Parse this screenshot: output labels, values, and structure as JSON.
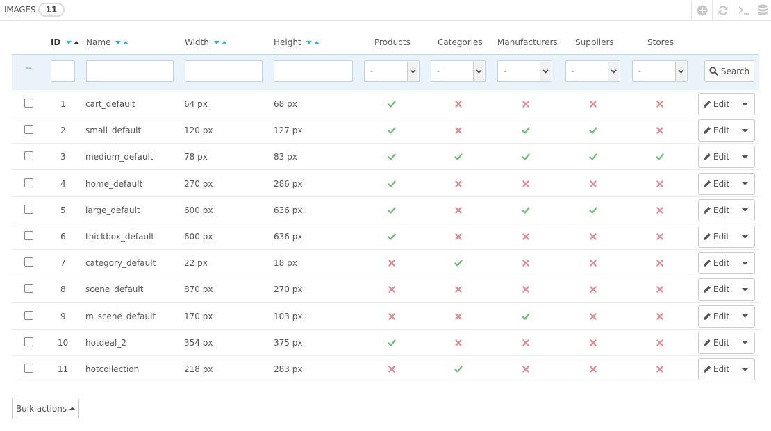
{
  "panel": {
    "title": "IMAGES",
    "count": "11"
  },
  "toolbar": {
    "icons": [
      "plus-circle-icon",
      "refresh-icon",
      "terminal-icon",
      "database-icon"
    ]
  },
  "columns": {
    "id": "ID",
    "name": "Name",
    "width": "Width",
    "height": "Height",
    "products": "Products",
    "categories": "Categories",
    "manufacturers": "Manufacturers",
    "suppliers": "Suppliers",
    "stores": "Stores"
  },
  "filters": {
    "placeholder_dash": "--",
    "select_value": "-",
    "search_label": "Search"
  },
  "rows": [
    {
      "id": "1",
      "name": "cart_default",
      "width": "64 px",
      "height": "68 px",
      "products": true,
      "categories": false,
      "manufacturers": false,
      "suppliers": false,
      "stores": false
    },
    {
      "id": "2",
      "name": "small_default",
      "width": "120 px",
      "height": "127 px",
      "products": true,
      "categories": false,
      "manufacturers": true,
      "suppliers": true,
      "stores": false
    },
    {
      "id": "3",
      "name": "medium_default",
      "width": "78 px",
      "height": "83 px",
      "products": true,
      "categories": true,
      "manufacturers": true,
      "suppliers": true,
      "stores": true
    },
    {
      "id": "4",
      "name": "home_default",
      "width": "270 px",
      "height": "286 px",
      "products": true,
      "categories": false,
      "manufacturers": false,
      "suppliers": false,
      "stores": false
    },
    {
      "id": "5",
      "name": "large_default",
      "width": "600 px",
      "height": "636 px",
      "products": true,
      "categories": false,
      "manufacturers": true,
      "suppliers": true,
      "stores": false
    },
    {
      "id": "6",
      "name": "thickbox_default",
      "width": "600 px",
      "height": "636 px",
      "products": true,
      "categories": false,
      "manufacturers": false,
      "suppliers": false,
      "stores": false
    },
    {
      "id": "7",
      "name": "category_default",
      "width": "22 px",
      "height": "18 px",
      "products": false,
      "categories": true,
      "manufacturers": false,
      "suppliers": false,
      "stores": false
    },
    {
      "id": "8",
      "name": "scene_default",
      "width": "870 px",
      "height": "270 px",
      "products": false,
      "categories": false,
      "manufacturers": false,
      "suppliers": false,
      "stores": false
    },
    {
      "id": "9",
      "name": "m_scene_default",
      "width": "170 px",
      "height": "103 px",
      "products": false,
      "categories": false,
      "manufacturers": true,
      "suppliers": false,
      "stores": false
    },
    {
      "id": "10",
      "name": "hotdeal_2",
      "width": "354 px",
      "height": "375 px",
      "products": true,
      "categories": false,
      "manufacturers": false,
      "suppliers": false,
      "stores": false
    },
    {
      "id": "11",
      "name": "hotcollection",
      "width": "218 px",
      "height": "283 px",
      "products": false,
      "categories": true,
      "manufacturers": false,
      "suppliers": false,
      "stores": false
    }
  ],
  "row_actions": {
    "edit_label": "Edit"
  },
  "footer": {
    "bulk_label": "Bulk actions"
  },
  "colors": {
    "check": "#72c279",
    "cross": "#e08f95",
    "sort_active": "#25b9d7"
  }
}
